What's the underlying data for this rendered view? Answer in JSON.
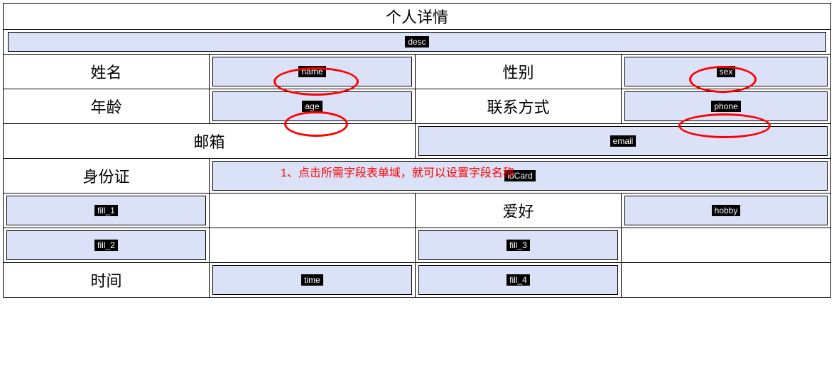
{
  "title": "个人详情",
  "fields": {
    "desc": "desc",
    "name": "name",
    "sex": "sex",
    "age": "age",
    "phone": "phone",
    "email": "email",
    "idCard": "idCard",
    "fill_1": "fill_1",
    "hobby": "hobby",
    "fill_2": "fill_2",
    "fill_3": "fill_3",
    "time": "time",
    "fill_4": "fill_4"
  },
  "labels": {
    "name": "姓名",
    "sex": "性别",
    "age": "年龄",
    "phone": "联系方式",
    "email": "邮箱",
    "idCard": "身份证",
    "hobby": "爱好",
    "time": "时间"
  },
  "annotation": "1、点击所需字段表单域，就可以设置字段名称"
}
